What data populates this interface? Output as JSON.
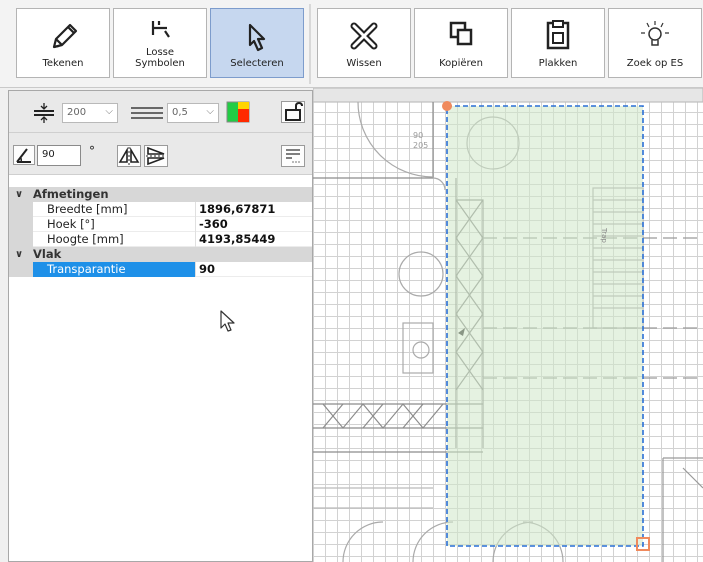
{
  "toolbar": {
    "tekenen": "Tekenen",
    "losse_symbolen_line1": "Losse",
    "losse_symbolen_line2": "Symbolen",
    "selecteren": "Selecteren",
    "wissen": "Wissen",
    "kopieren": "Kopiëren",
    "plakken": "Plakken",
    "zoek_op_es": "Zoek op ES"
  },
  "options": {
    "thickness_value": "200",
    "line_width_value": "0,5",
    "rotation_value": "90",
    "degree_symbol": "°",
    "fill_color": "#ff2a00",
    "fill_color_2": "#22cc44"
  },
  "properties": {
    "categories": [
      {
        "label": "Afmetingen",
        "items": [
          {
            "name": "Breedte [mm]",
            "value": "1896,67871"
          },
          {
            "name": "Hoek [°]",
            "value": "-360"
          },
          {
            "name": "Hoogte [mm]",
            "value": "4193,85449"
          }
        ]
      },
      {
        "label": "Vlak",
        "items": [
          {
            "name": "Transparantie",
            "value": "90"
          }
        ]
      }
    ]
  },
  "canvas": {
    "door_label_1": "90",
    "door_label_2": "205",
    "stair_label": "Trap",
    "selection_fill": "#cfe8c8",
    "selection_border": "#2a6fd6",
    "handle_color": "#f08a5d"
  }
}
